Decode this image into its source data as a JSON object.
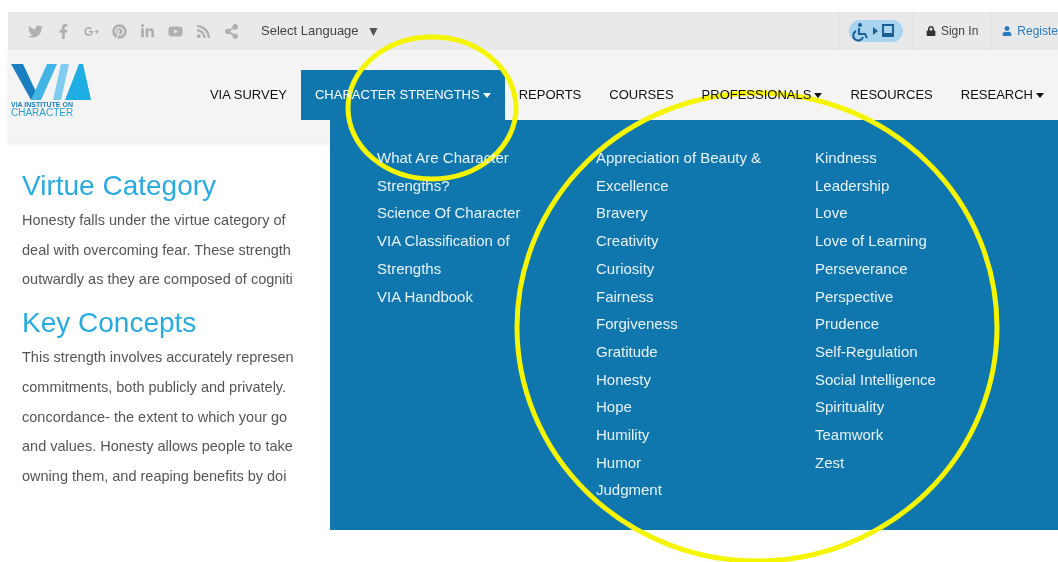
{
  "top_bar": {
    "language_select": {
      "label": "Select Language",
      "caret": "▼"
    },
    "sign_in": "Sign In",
    "register": "Registe"
  },
  "logo": {
    "line_1": "VIA INSTITUTE ON",
    "line_2": "CHARACTER"
  },
  "nav": [
    {
      "label": "VIA SURVEY",
      "has_caret": false,
      "selected": false
    },
    {
      "label": "CHARACTER STRENGTHS",
      "has_caret": true,
      "selected": true
    },
    {
      "label": "REPORTS",
      "has_caret": false,
      "selected": false
    },
    {
      "label": "COURSES",
      "has_caret": false,
      "selected": false
    },
    {
      "label": "PROFESSIONALS",
      "has_caret": true,
      "selected": false
    },
    {
      "label": "RESOURCES",
      "has_caret": false,
      "selected": false
    },
    {
      "label": "RESEARCH",
      "has_caret": true,
      "selected": false
    }
  ],
  "dropdown": {
    "columns": [
      [
        "What Are Character Strengths?",
        "Science Of Character",
        "VIA Classification of Strengths",
        "VIA Handbook"
      ],
      [
        "Appreciation of Beauty & Excellence",
        "Bravery",
        "Creativity",
        "Curiosity",
        "Fairness",
        "Forgiveness",
        "Gratitude",
        "Honesty",
        "Hope",
        "Humility",
        "Humor",
        "Judgment"
      ],
      [
        "Kindness",
        "Leadership",
        "Love",
        "Love of Learning",
        "Perseverance",
        "Perspective",
        "Prudence",
        "Self-Regulation",
        "Social Intelligence",
        "Spirituality",
        "Teamwork",
        "Zest"
      ]
    ]
  },
  "content": [
    {
      "heading": "Virtue Category",
      "lines": [
        "Honesty falls under the virtue category of",
        "deal with overcoming fear. These strength",
        "outwardly as they are composed of cogniti"
      ]
    },
    {
      "heading": "Key Concepts",
      "lines": [
        "This strength involves accurately represen",
        "commitments, both publicly and privately.",
        "concordance- the extent to which your go",
        "and values. Honesty allows people to take",
        "owning them, and reaping benefits by doi"
      ]
    }
  ]
}
